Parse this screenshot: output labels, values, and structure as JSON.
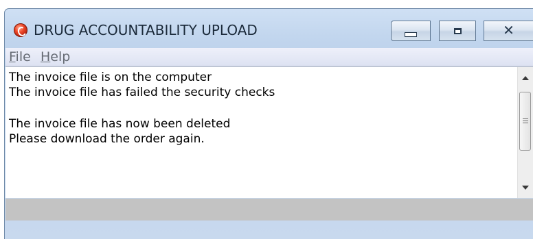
{
  "window": {
    "title": "DRUG ACCOUNTABILITY UPLOAD",
    "icon": "app-logo-icon",
    "caption_buttons": {
      "minimize": "minimize-icon",
      "maximize": "maximize-icon",
      "close": "close-icon",
      "close_glyph": "✕"
    }
  },
  "menu": {
    "file": {
      "mnemonic": "F",
      "rest": "ile"
    },
    "help": {
      "mnemonic": "H",
      "rest": "elp"
    }
  },
  "messages": [
    "The invoice file is on the computer",
    "The invoice file has failed the security checks",
    "",
    "The invoice file has now been deleted",
    "Please download the order again."
  ],
  "status": {
    "text": ""
  },
  "colors": {
    "titlebar": "#c2d6ee",
    "status_bar": "#c3c3c3",
    "menu_text": "#666b74"
  }
}
